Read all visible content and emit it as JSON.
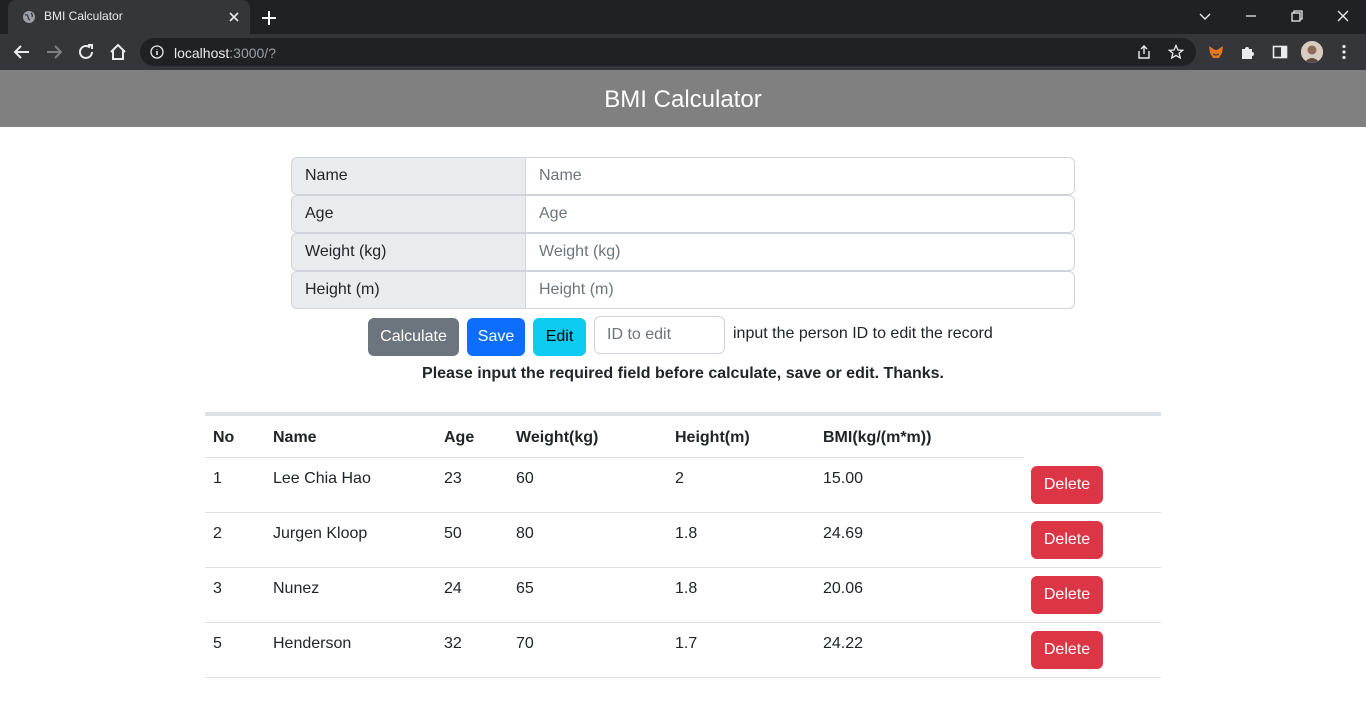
{
  "browser": {
    "tab_title": "BMI Calculator",
    "url_host": "localhost",
    "url_rest": ":3000/?"
  },
  "header": {
    "title": "BMI Calculator"
  },
  "form": {
    "fields": [
      {
        "label": "Name",
        "placeholder": "Name",
        "value": ""
      },
      {
        "label": "Age",
        "placeholder": "Age",
        "value": ""
      },
      {
        "label": "Weight (kg)",
        "placeholder": "Weight (kg)",
        "value": ""
      },
      {
        "label": "Height (m)",
        "placeholder": "Height (m)",
        "value": ""
      }
    ],
    "buttons": {
      "calculate": "Calculate",
      "save": "Save",
      "edit": "Edit"
    },
    "id_placeholder": "ID to edit",
    "id_hint": "input the person ID to edit the record",
    "notice": "Please input the required field before calculate, save or edit. Thanks."
  },
  "table": {
    "headers": [
      "No",
      "Name",
      "Age",
      "Weight(kg)",
      "Height(m)",
      "BMI(kg/(m*m))"
    ],
    "rows": [
      {
        "no": "1",
        "name": "Lee Chia Hao",
        "age": "23",
        "weight": "60",
        "height": "2",
        "bmi": "15.00",
        "action": "Delete"
      },
      {
        "no": "2",
        "name": "Jurgen Kloop",
        "age": "50",
        "weight": "80",
        "height": "1.8",
        "bmi": "24.69",
        "action": "Delete"
      },
      {
        "no": "3",
        "name": "Nunez",
        "age": "24",
        "weight": "65",
        "height": "1.8",
        "bmi": "20.06",
        "action": "Delete"
      },
      {
        "no": "5",
        "name": "Henderson",
        "age": "32",
        "weight": "70",
        "height": "1.7",
        "bmi": "24.22",
        "action": "Delete"
      }
    ]
  },
  "colors": {
    "header_bg": "#808080",
    "calculate": "#6c757d",
    "save": "#0d6efd",
    "edit": "#0dcaf0",
    "delete": "#dc3545"
  }
}
